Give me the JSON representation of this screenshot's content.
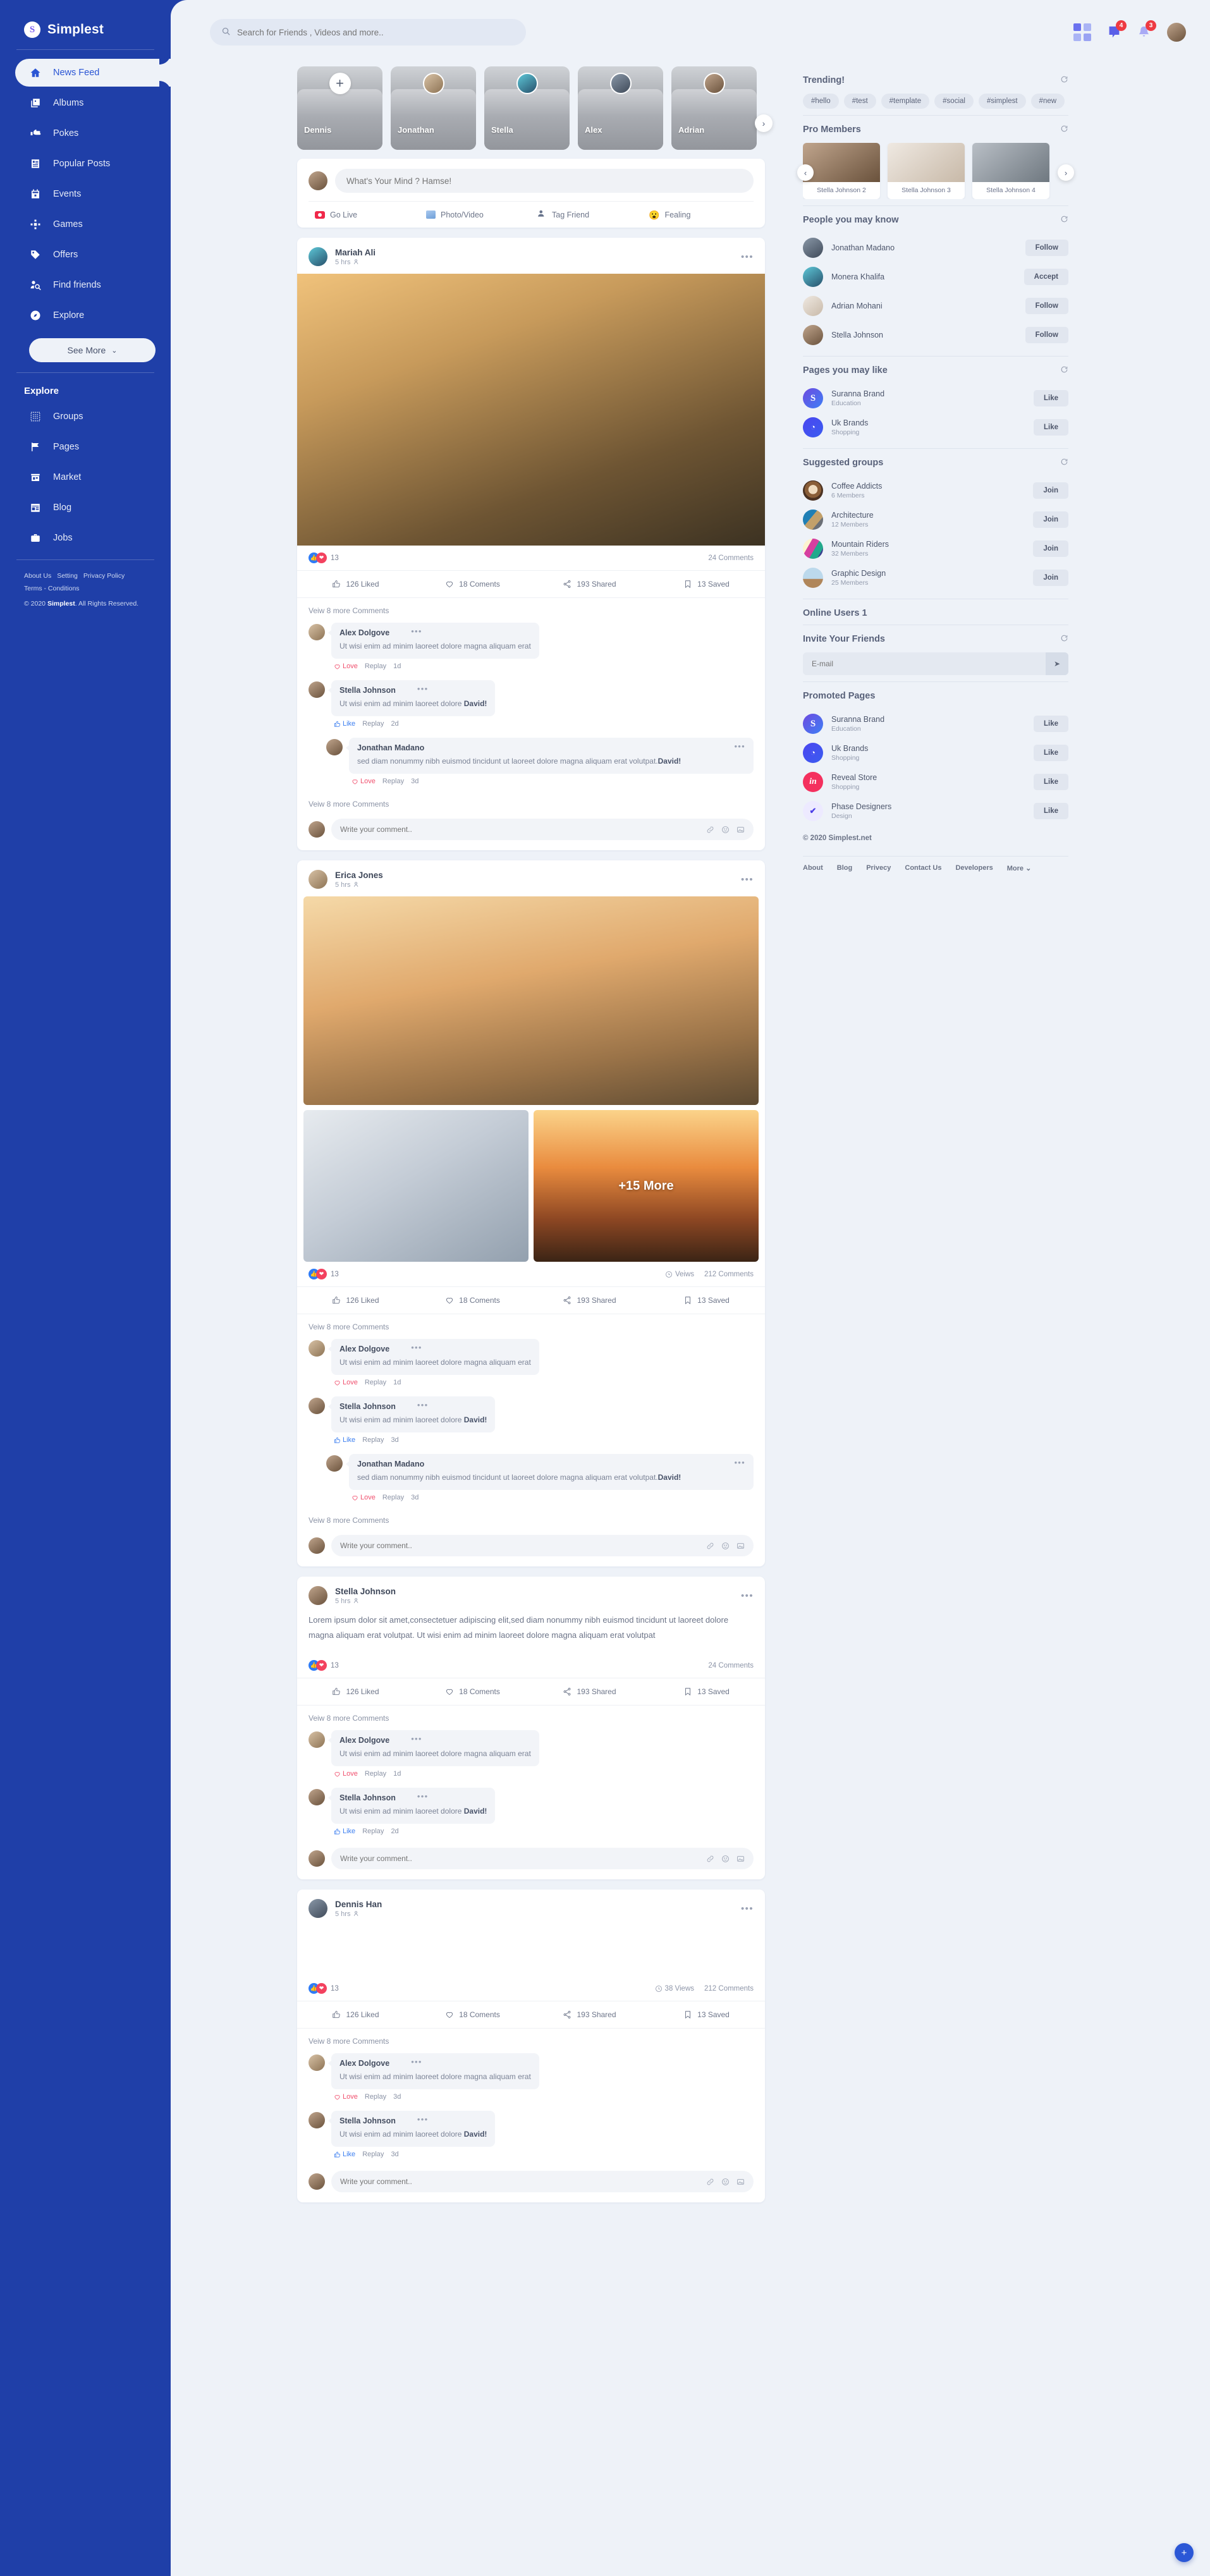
{
  "brand": {
    "logo_letter": "S",
    "name": "Simplest"
  },
  "sidebar": {
    "nav": [
      {
        "label": "News Feed",
        "icon": "home-icon"
      },
      {
        "label": "Albums",
        "icon": "albums-icon"
      },
      {
        "label": "Pokes",
        "icon": "poke-hand-icon"
      },
      {
        "label": "Popular Posts",
        "icon": "popular-posts-icon"
      },
      {
        "label": "Events",
        "icon": "calendar-icon"
      },
      {
        "label": "Games",
        "icon": "gamepad-icon"
      },
      {
        "label": "Offers",
        "icon": "tag-icon"
      },
      {
        "label": "Find friends",
        "icon": "find-friends-icon"
      },
      {
        "label": "Explore",
        "icon": "compass-icon"
      }
    ],
    "see_more": "See More",
    "explore_heading": "Explore",
    "explore": [
      {
        "label": "Groups",
        "icon": "groups-icon"
      },
      {
        "label": "Pages",
        "icon": "flag-icon"
      },
      {
        "label": "Market",
        "icon": "store-icon"
      },
      {
        "label": "Blog",
        "icon": "blog-icon"
      },
      {
        "label": "Jobs",
        "icon": "briefcase-icon"
      }
    ],
    "footer_links": [
      "About Us",
      "Setting",
      "Privacy Policy",
      "Terms - Conditions"
    ],
    "copyright_prefix": "© 2020 ",
    "copyright_brand": "Simplest",
    "copyright_suffix": ". All Rights Reserved."
  },
  "topbar": {
    "search_placeholder": "Search for Friends , Videos and more..",
    "messages_badge": "4",
    "notifications_badge": "3"
  },
  "stories": {
    "add_label": "+",
    "items": [
      {
        "name": "Dennis"
      },
      {
        "name": "Jonathan"
      },
      {
        "name": "Stella"
      },
      {
        "name": "Alex"
      },
      {
        "name": "Adrian"
      }
    ],
    "next_arrow": "›"
  },
  "composer": {
    "placeholder": "What's Your Mind ? Hamse!",
    "actions": [
      {
        "label": "Go Live",
        "icon": "live-icon"
      },
      {
        "label": "Photo/Video",
        "icon": "photo-video-icon"
      },
      {
        "label": "Tag Friend",
        "icon": "tag-friend-icon"
      },
      {
        "label": "Fealing",
        "icon": "feeling-icon",
        "glyph": "😮"
      }
    ]
  },
  "stats_labels": {
    "liked": "126 Liked",
    "comments": "18 Coments",
    "shared": "193 Shared",
    "saved": "13 Saved"
  },
  "view_more_comments": "Veiw 8 more Comments",
  "comment_placeholder": "Write your comment..",
  "posts": [
    {
      "author": "Mariah Ali",
      "time": "5 hrs",
      "reaction_count": "13",
      "comments_count": "24 Comments",
      "views": "",
      "comments": [
        {
          "name": "Alex Dolgove",
          "text": "Ut wisi enim ad minim laoreet dolore magna aliquam erat",
          "action": "Love",
          "replay": "Replay",
          "age": "1d",
          "nested": false
        },
        {
          "name": "Stella Johnson",
          "text": "Ut wisi enim ad minim laoreet dolore ",
          "bold": "David!",
          "action": "Like",
          "replay": "Replay",
          "age": "2d",
          "nested": false
        },
        {
          "name": "Jonathan Madano",
          "text": "sed diam nonummy nibh euismod tincidunt ut laoreet dolore magna aliquam erat volutpat.",
          "bold": "David!",
          "action": "Love",
          "replay": "Replay",
          "age": "3d",
          "nested": true
        }
      ]
    },
    {
      "author": "Erica Jones",
      "time": "5 hrs",
      "reaction_count": "13",
      "comments_count": "212 Comments",
      "views": "Veiws",
      "gallery_more": "+15 More",
      "comments": [
        {
          "name": "Alex Dolgove",
          "text": "Ut wisi enim ad minim laoreet dolore magna aliquam erat",
          "action": "Love",
          "replay": "Replay",
          "age": "1d",
          "nested": false
        },
        {
          "name": "Stella Johnson",
          "text": "Ut wisi enim ad minim laoreet dolore ",
          "bold": "David!",
          "action": "Like",
          "replay": "Replay",
          "age": "3d",
          "nested": false
        },
        {
          "name": "Jonathan Madano",
          "text": "sed diam nonummy nibh euismod tincidunt ut laoreet dolore magna aliquam erat volutpat.",
          "bold": "David!",
          "action": "Love",
          "replay": "Replay",
          "age": "3d",
          "nested": true
        }
      ]
    },
    {
      "author": "Stella Johnson",
      "time": "5 hrs",
      "text": "Lorem ipsum dolor sit amet,consectetuer adipiscing elit,sed diam nonummy nibh euismod tincidunt ut laoreet dolore magna aliquam erat volutpat. Ut wisi enim ad minim laoreet dolore magna aliquam erat volutpat",
      "reaction_count": "13",
      "comments_count": "24 Comments",
      "views": "",
      "comments": [
        {
          "name": "Alex Dolgove",
          "text": "Ut wisi enim ad minim laoreet dolore magna aliquam erat",
          "action": "Love",
          "replay": "Replay",
          "age": "1d",
          "nested": false
        },
        {
          "name": "Stella Johnson",
          "text": "Ut wisi enim ad minim laoreet dolore ",
          "bold": "David!",
          "action": "Like",
          "replay": "Replay",
          "age": "2d",
          "nested": false
        }
      ]
    },
    {
      "author": "Dennis Han",
      "time": "5 hrs",
      "reaction_count": "13",
      "comments_count": "212 Comments",
      "views": "38 Views",
      "comments": [
        {
          "name": "Alex Dolgove",
          "text": "Ut wisi enim ad minim laoreet dolore magna aliquam erat",
          "action": "Love",
          "replay": "Replay",
          "age": "3d",
          "nested": false
        },
        {
          "name": "Stella Johnson",
          "text": "Ut wisi enim ad minim laoreet dolore ",
          "bold": "David!",
          "action": "Like",
          "replay": "Replay",
          "age": "3d",
          "nested": false
        }
      ]
    }
  ],
  "rail": {
    "trending_title": "Trending!",
    "tags": [
      "#hello",
      "#test",
      "#template",
      "#social",
      "#simplest",
      "#new"
    ],
    "pro_title": "Pro Members",
    "pro_members": [
      {
        "name": "Stella Johnson 2"
      },
      {
        "name": "Stella Johnson 3"
      },
      {
        "name": "Stella Johnson 4"
      }
    ],
    "people_title": "People you may know",
    "people": [
      {
        "name": "Jonathan Madano",
        "action": "Follow"
      },
      {
        "name": "Monera Khalifa",
        "action": "Accept"
      },
      {
        "name": "Adrian Mohani",
        "action": "Follow"
      },
      {
        "name": "Stella Johnson",
        "action": "Follow"
      }
    ],
    "pages_title": "Pages you may like",
    "pages": [
      {
        "name": "Suranna Brand",
        "category": "Education",
        "action": "Like",
        "logo": "s-logo-icon"
      },
      {
        "name": "Uk Brands",
        "category": "Shopping",
        "action": "Like",
        "logo": "uk-logo-icon"
      }
    ],
    "groups_title": "Suggested groups",
    "groups": [
      {
        "name": "Coffee Addicts",
        "members": "6 Members",
        "action": "Join"
      },
      {
        "name": "Architecture",
        "members": "12 Members",
        "action": "Join"
      },
      {
        "name": "Mountain Riders",
        "members": "32 Members",
        "action": "Join"
      },
      {
        "name": "Graphic Design",
        "members": "25 Members",
        "action": "Join"
      }
    ],
    "online_title": "Online Users 1",
    "invite_title": "Invite Your Friends",
    "invite_placeholder": "E-mail",
    "invite_send": "➤",
    "promoted_title": "Promoted Pages",
    "promoted": [
      {
        "name": "Suranna Brand",
        "category": "Education",
        "action": "Like",
        "logo": "s-logo-icon"
      },
      {
        "name": "Uk Brands",
        "category": "Shopping",
        "action": "Like",
        "logo": "uk-logo-icon"
      },
      {
        "name": "Reveal Store",
        "category": "Shopping",
        "action": "Like",
        "logo": "in-logo-icon"
      },
      {
        "name": "Phase Designers",
        "category": "Design",
        "action": "Like",
        "logo": "phase-logo-icon"
      }
    ],
    "copyright": "© 2020 Simplest.net",
    "links": [
      "About",
      "Blog",
      "Privecy",
      "Contact Us",
      "Developers",
      "More ⌄"
    ]
  },
  "fab": "+"
}
